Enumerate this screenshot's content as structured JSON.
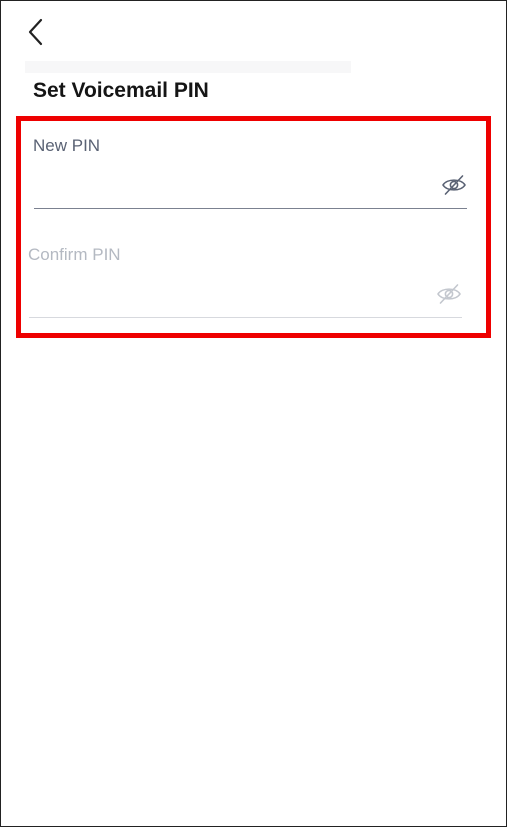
{
  "header": {
    "back_icon": "chevron-left-icon",
    "title": "Set Voicemail PIN"
  },
  "form": {
    "new_pin": {
      "label": "New PIN",
      "value": "",
      "placeholder": "",
      "toggle_icon": "eye-off-icon",
      "state": "active"
    },
    "confirm_pin": {
      "label": "Confirm PIN",
      "value": "",
      "placeholder": "",
      "toggle_icon": "eye-off-icon",
      "state": "inactive"
    }
  },
  "colors": {
    "highlight": "#ee0000",
    "title_text": "#151515",
    "active_label": "#5a6274",
    "inactive_label": "#b4b9c2",
    "active_underline": "#7b8190",
    "inactive_underline": "#d7d9de"
  }
}
